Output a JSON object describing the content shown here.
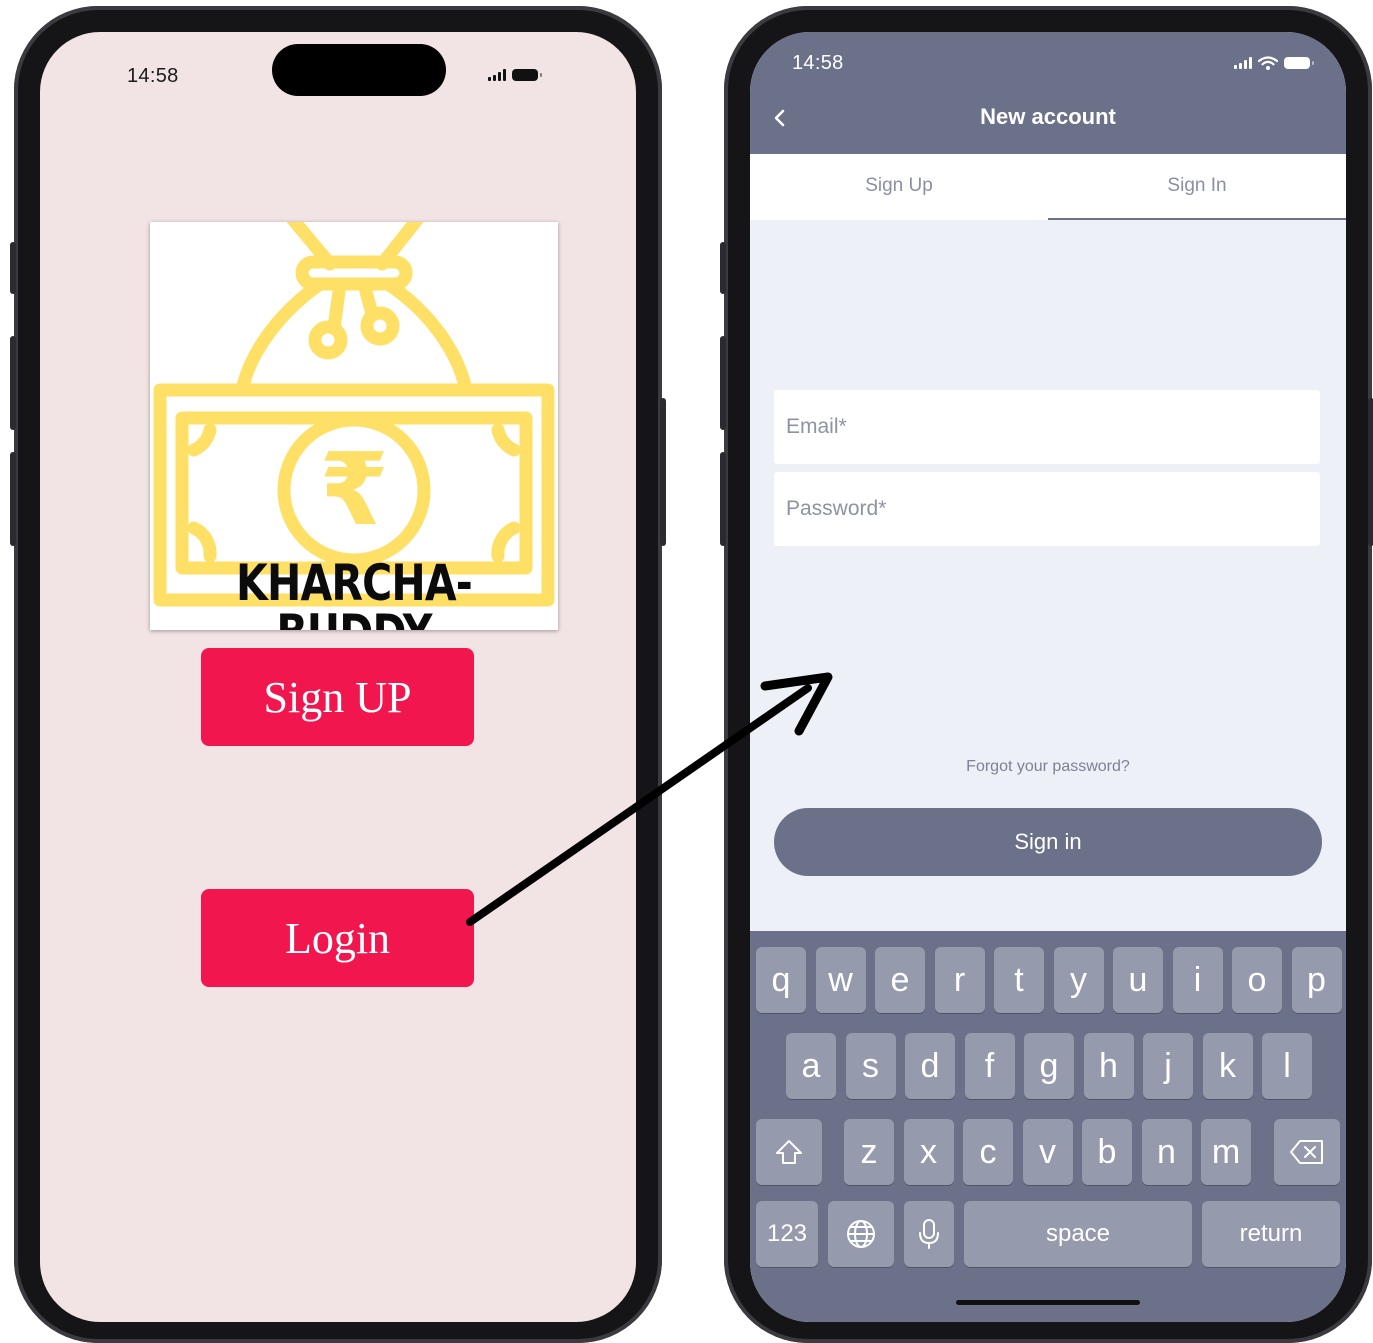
{
  "left_screen": {
    "status": {
      "time": "14:58"
    },
    "logo": {
      "brand": "KHARCHA-BUDDY",
      "icon": "money-bag-rupee-icon",
      "color": "#ffe066"
    },
    "buttons": {
      "signup_label": "Sign UP",
      "login_label": "Login",
      "color": "#f2164f"
    }
  },
  "right_screen": {
    "status": {
      "time": "14:58"
    },
    "header": {
      "title": "New account",
      "back_icon": "chevron-left-icon"
    },
    "tabs": [
      {
        "label": "Sign Up",
        "active": false
      },
      {
        "label": "Sign In",
        "active": true
      }
    ],
    "form": {
      "email_placeholder": "Email*",
      "password_placeholder": "Password*",
      "forgot_label": "Forgot your password?",
      "signin_label": "Sign in"
    },
    "keyboard": {
      "row1": [
        "q",
        "w",
        "e",
        "r",
        "t",
        "y",
        "u",
        "i",
        "o",
        "p"
      ],
      "row2": [
        "a",
        "s",
        "d",
        "f",
        "g",
        "h",
        "j",
        "k",
        "l"
      ],
      "row3": [
        "z",
        "x",
        "c",
        "v",
        "b",
        "n",
        "m"
      ],
      "shift_icon": "shift-icon",
      "backspace_icon": "backspace-icon",
      "numbers_label": "123",
      "globe_icon": "globe-icon",
      "mic_icon": "microphone-icon",
      "space_label": "space",
      "return_label": "return"
    },
    "theme_color": "#6b7189"
  },
  "annotation": {
    "arrow": "arrow-from-login-to-signin-screen"
  }
}
